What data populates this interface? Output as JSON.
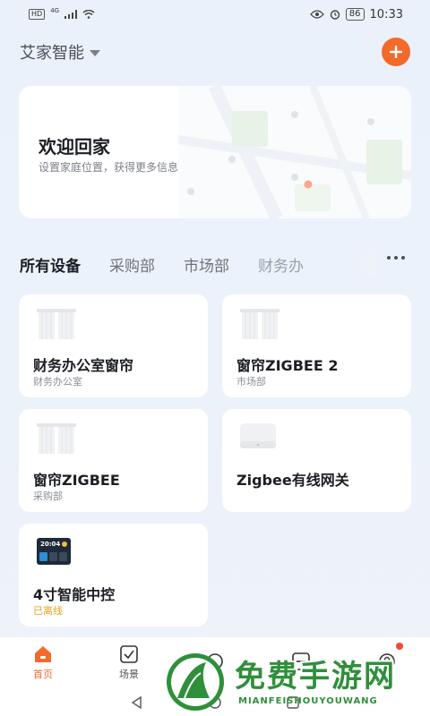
{
  "status_bar": {
    "network": "HD",
    "signal": "4G",
    "battery": "86",
    "time": "10:33"
  },
  "header": {
    "home_name": "艾家智能",
    "accent_color": "#f36a2a"
  },
  "welcome": {
    "title": "欢迎回家",
    "subtitle": "设置家庭位置，获得更多信息"
  },
  "tabs": [
    {
      "label": "所有设备",
      "active": true
    },
    {
      "label": "采购部",
      "active": false
    },
    {
      "label": "市场部",
      "active": false
    },
    {
      "label": "财务办",
      "active": false
    }
  ],
  "devices": [
    {
      "name": "财务办公室窗帘",
      "room": "财务办公室",
      "icon": "curtain-icon"
    },
    {
      "name": "窗帘ZIGBEE 2",
      "room": "市场部",
      "icon": "curtain-icon"
    },
    {
      "name": "窗帘ZIGBEE",
      "room": "采购部",
      "icon": "curtain-icon"
    },
    {
      "name": "Zigbee有线网关",
      "room": "",
      "icon": "gateway-icon"
    },
    {
      "name": "4寸智能中控",
      "room": "已离线",
      "icon": "control-panel-icon"
    }
  ],
  "control_panel_screen": {
    "time": "20:04"
  },
  "bottom_nav": [
    {
      "label": "首页",
      "active": true,
      "icon": "home-icon"
    },
    {
      "label": "场景",
      "active": false,
      "icon": "scene-icon"
    },
    {
      "label": "",
      "active": false,
      "icon": "smart-icon"
    },
    {
      "label": "",
      "active": false,
      "icon": "message-icon"
    },
    {
      "label": "",
      "active": false,
      "icon": "profile-icon"
    }
  ],
  "watermark": {
    "title": "免费手游网",
    "subtitle": "MIANFEISHOUYOUWANG"
  }
}
